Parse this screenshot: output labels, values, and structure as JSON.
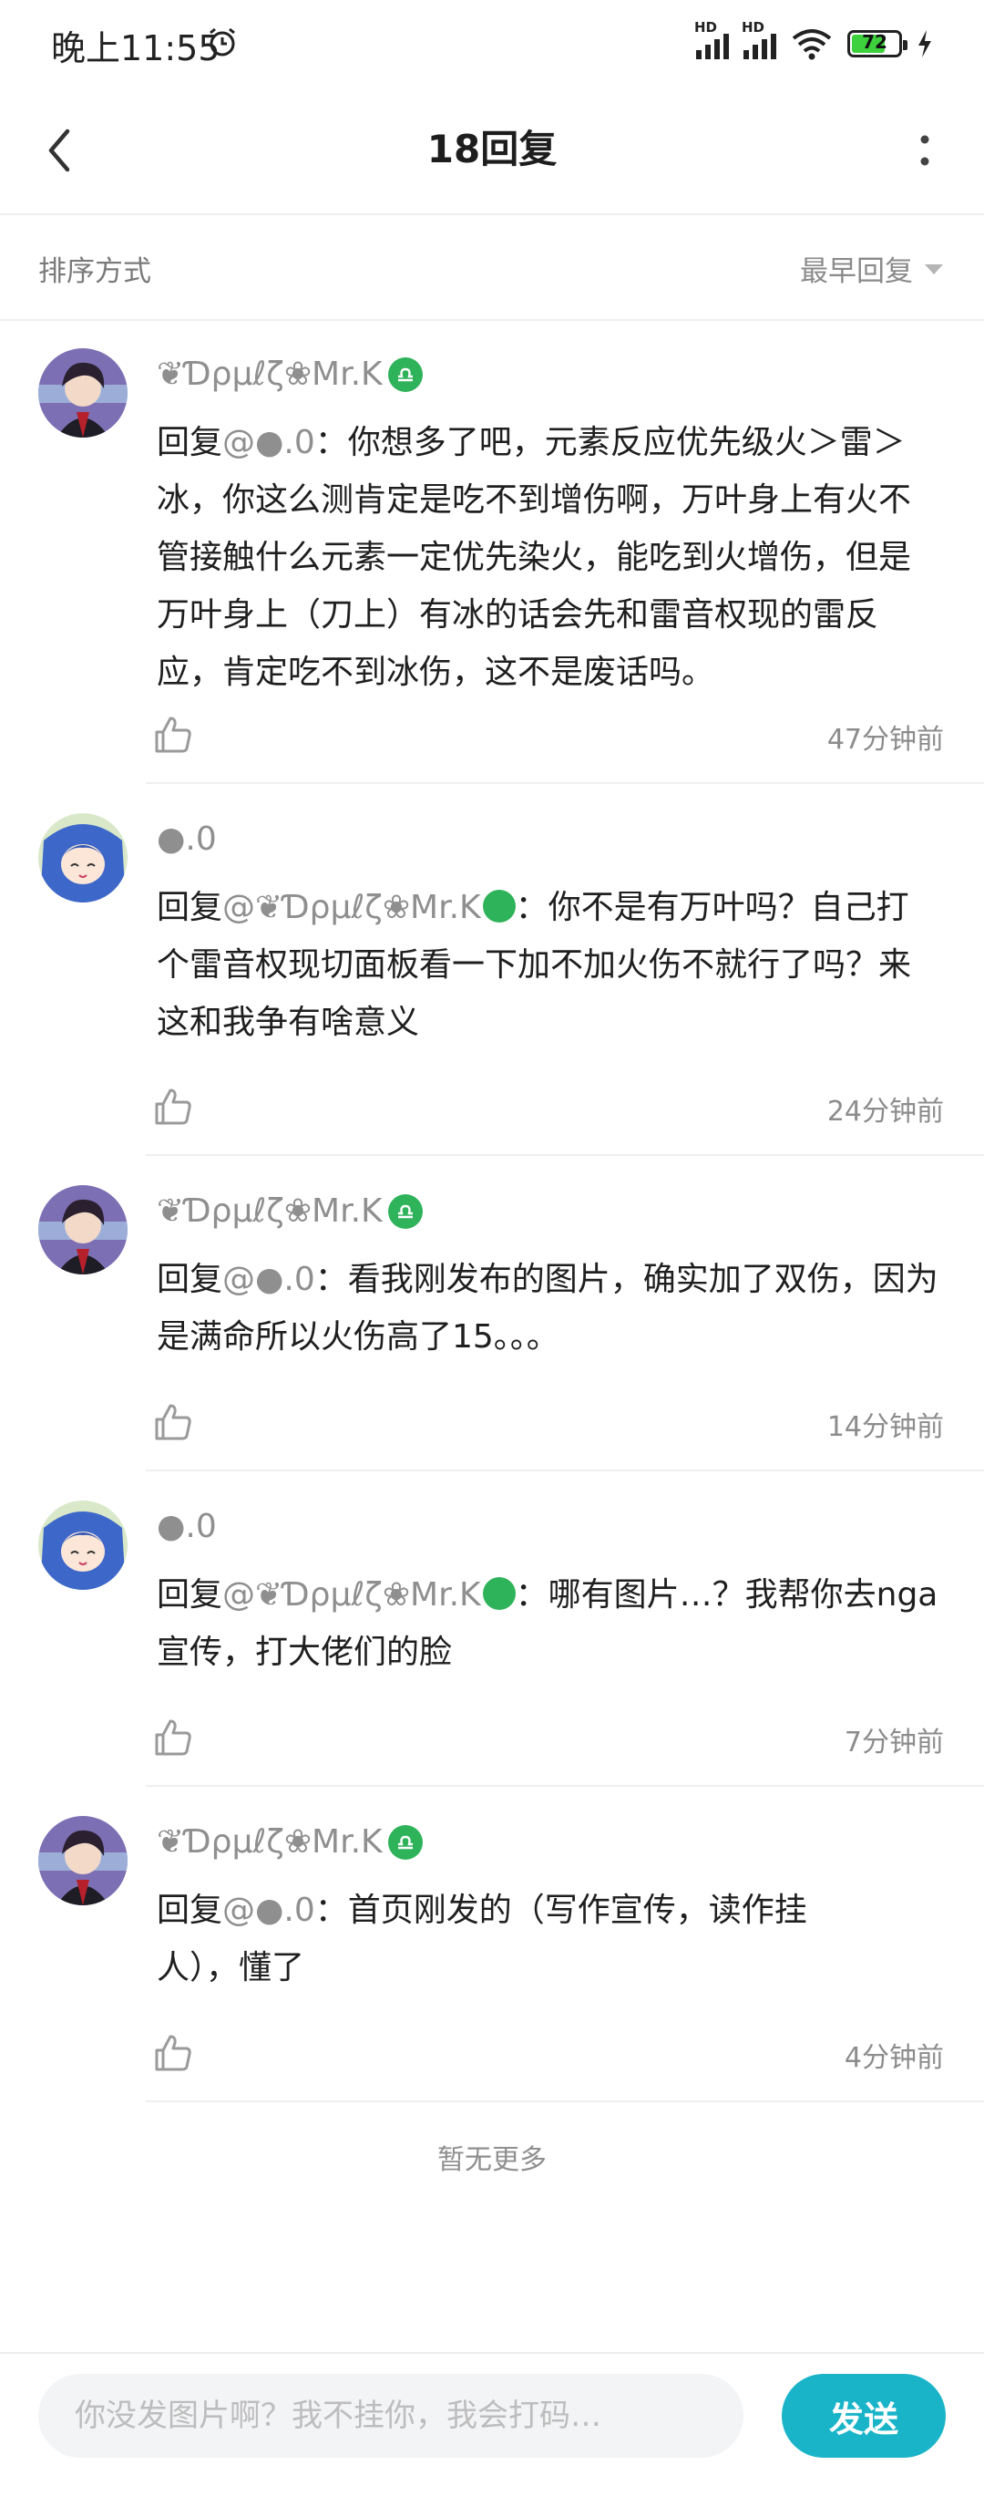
{
  "status_bar": {
    "time": "晚上11:55",
    "battery_level": "72",
    "signal_labels": [
      "HD",
      "HD"
    ]
  },
  "nav": {
    "title": "18回复"
  },
  "sort": {
    "label": "排序方式",
    "value": "最早回复"
  },
  "comments": [
    {
      "username": "❦Ɗρμℓζ❀Mr.K",
      "reply_prefix": "回复",
      "reply_to": "@●.0",
      "text": "：你想多了吧，元素反应优先级火＞雷＞冰，你这么测肯定是吃不到增伤啊，万叶身上有火不管接触什么元素一定优先染火，能吃到火增伤，但是万叶身上（刀上）有冰的话会先和雷音权现的雷反应，肯定吃不到冰伤，这不是废话吗。",
      "time": "47分钟前"
    },
    {
      "username": "●.0",
      "reply_prefix": "回复",
      "reply_to": "@❦Ɗρμℓζ❀Mr.K",
      "text": "：你不是有万叶吗？自己打个雷音权现切面板看一下加不加火伤不就行了吗？来这和我争有啥意义",
      "time": "24分钟前"
    },
    {
      "username": "❦Ɗρμℓζ❀Mr.K",
      "reply_prefix": "回复",
      "reply_to": "@●.0",
      "text": "：看我刚发布的图片，确实加了双伤，因为是满命所以火伤高了15。。。",
      "time": "14分钟前"
    },
    {
      "username": "●.0",
      "reply_prefix": "回复",
      "reply_to": "@❦Ɗρμℓζ❀Mr.K",
      "text": "：哪有图片…？我帮你去nga宣传，打大佬们的脸",
      "time": "7分钟前"
    },
    {
      "username": "❦Ɗρμℓζ❀Mr.K",
      "reply_prefix": "回复",
      "reply_to": "@●.0",
      "text": "：首页刚发的（写作宣传，读作挂人），懂了",
      "time": "4分钟前"
    }
  ],
  "footer_text": "暂无更多",
  "input": {
    "placeholder": "你没发图片啊？我不挂你，我会打码…",
    "send_label": "发送"
  },
  "colors": {
    "accent": "#1ab4c9",
    "badge_green": "#2fb35a",
    "battery_green": "#3dd13d",
    "muted_text": "#8f8f8f"
  },
  "icons": [
    "alarm-icon",
    "signal-icon",
    "wifi-icon",
    "battery-icon",
    "charging-icon",
    "back-arrow-icon",
    "more-vertical-icon",
    "dropdown-triangle-icon",
    "thumbs-up-icon",
    "libra-badge-icon"
  ]
}
